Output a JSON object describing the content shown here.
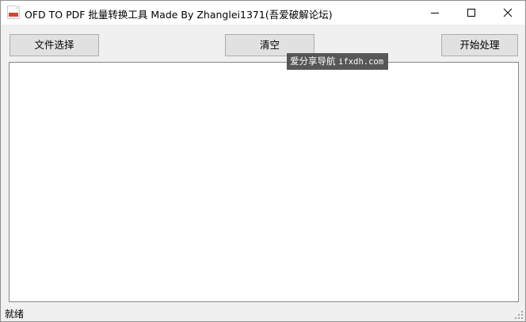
{
  "window": {
    "title": "OFD TO PDF 批量转换工具  Made By Zhanglei1371(吾爱破解论坛)"
  },
  "controls": {
    "minimize_icon": "minimize-icon",
    "maximize_icon": "maximize-icon",
    "close_icon": "close-icon"
  },
  "toolbar": {
    "select_label": "文件选择",
    "clear_label": "清空",
    "start_label": "开始处理"
  },
  "file_list": {
    "items": []
  },
  "watermark": {
    "site_name": "爱分享导航",
    "site_domain": "ifxdh.com"
  },
  "status": {
    "text": "就绪"
  },
  "colors": {
    "window_bg": "#f0f0f0",
    "titlebar_bg": "#ffffff",
    "button_bg": "#e1e1e1",
    "button_border": "#adadad",
    "list_border": "#828790",
    "watermark_bg": "#4f4f4f",
    "app_icon_accent": "#d9452b"
  }
}
